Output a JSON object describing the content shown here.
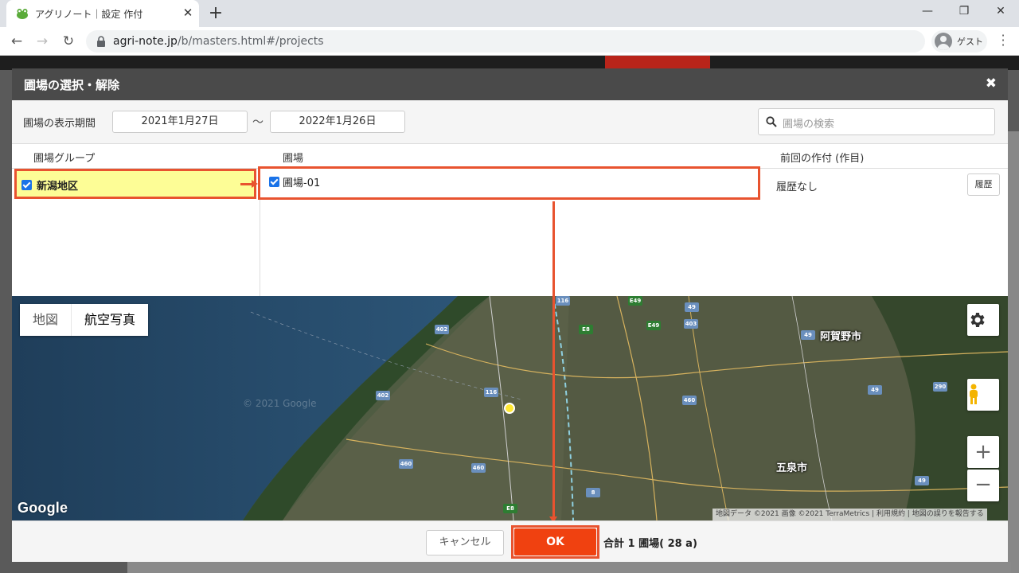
{
  "browser": {
    "tab_title": "アグリノート｜設定 作付",
    "url_host": "agri-note.jp",
    "url_path": "/b/masters.html#/projects",
    "profile_label": "ゲスト",
    "tab_close": "✕",
    "new_tab": "+",
    "minimize": "—",
    "restore": "❐",
    "close": "✕"
  },
  "modal": {
    "title": "圃場の選択・解除",
    "close": "✖",
    "period_label": "圃場の表示期間",
    "date_from": "2021年1月27日",
    "tilde": "～",
    "date_to": "2022年1月26日",
    "search_placeholder": "圃場の検索",
    "columns": {
      "group": "圃場グループ",
      "field": "圃場",
      "previous_crop": "前回の作付 (作目)"
    },
    "group_row": {
      "label": "新潟地区",
      "checked": true
    },
    "field_row": {
      "label": "圃場-01",
      "checked": true,
      "previous": "履歴なし",
      "history_button": "履歴"
    }
  },
  "map": {
    "type_buttons": [
      "地図",
      "航空写真"
    ],
    "selected_type": "航空写真",
    "settings_icon": "gear-icon",
    "pegman_icon": "pegman-icon",
    "zoom_in": "+",
    "zoom_out": "−",
    "logo": "Google",
    "watermark": "© 2021 Google",
    "attribution": "地図データ ©2021 画像 ©2021 TerraMetrics  |  利用規約  |  地図の誤りを報告する",
    "city_labels": {
      "agano": "阿賀野市",
      "gosen": "五泉市"
    },
    "roads": [
      "402",
      "402",
      "116",
      "116",
      "460",
      "460",
      "460",
      "E8",
      "E8",
      "E49",
      "E49",
      "49",
      "49",
      "403",
      "49",
      "290",
      "8",
      "49"
    ]
  },
  "footer": {
    "cancel": "キャンセル",
    "ok": "OK",
    "total": "合計 1 圃場( 28 a)"
  },
  "colors": {
    "accent_orange": "#f04110",
    "highlight_border": "#e8532f",
    "group_highlight": "#fdfd96",
    "modal_header": "#4a4a4a"
  }
}
